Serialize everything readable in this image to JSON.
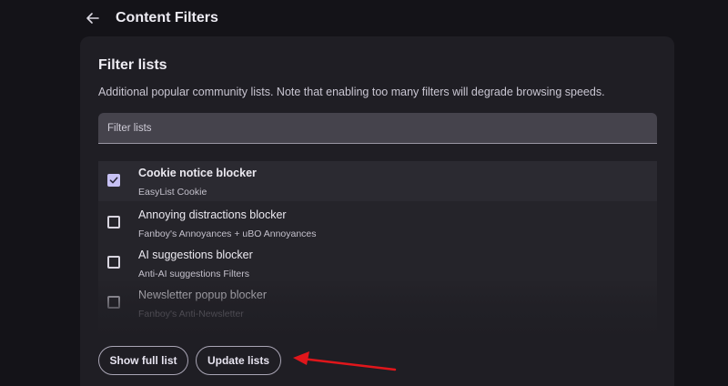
{
  "header": {
    "title": "Content Filters",
    "back_icon": "arrow-left-icon"
  },
  "filter_lists": {
    "title": "Filter lists",
    "description": "Additional popular community lists. Note that enabling too many filters will degrade browsing speeds.",
    "search": {
      "placeholder": "Filter lists",
      "value": ""
    },
    "items": [
      {
        "title": "Cookie notice blocker",
        "subtitle": "EasyList Cookie",
        "checked": true
      },
      {
        "title": "Annoying distractions blocker",
        "subtitle": "Fanboy's Annoyances + uBO Annoyances",
        "checked": false
      },
      {
        "title": "AI suggestions blocker",
        "subtitle": "Anti-AI suggestions Filters",
        "checked": false
      },
      {
        "title": "Newsletter popup blocker",
        "subtitle": "Fanboy's Anti-Newsletter",
        "checked": false
      }
    ],
    "buttons": {
      "show_full_list": "Show full list",
      "update_lists": "Update lists"
    }
  },
  "colors": {
    "background": "#141318",
    "card": "#1f1e24",
    "checkbox_checked": "#c7c1f4",
    "annotation_arrow": "#e0161b"
  }
}
